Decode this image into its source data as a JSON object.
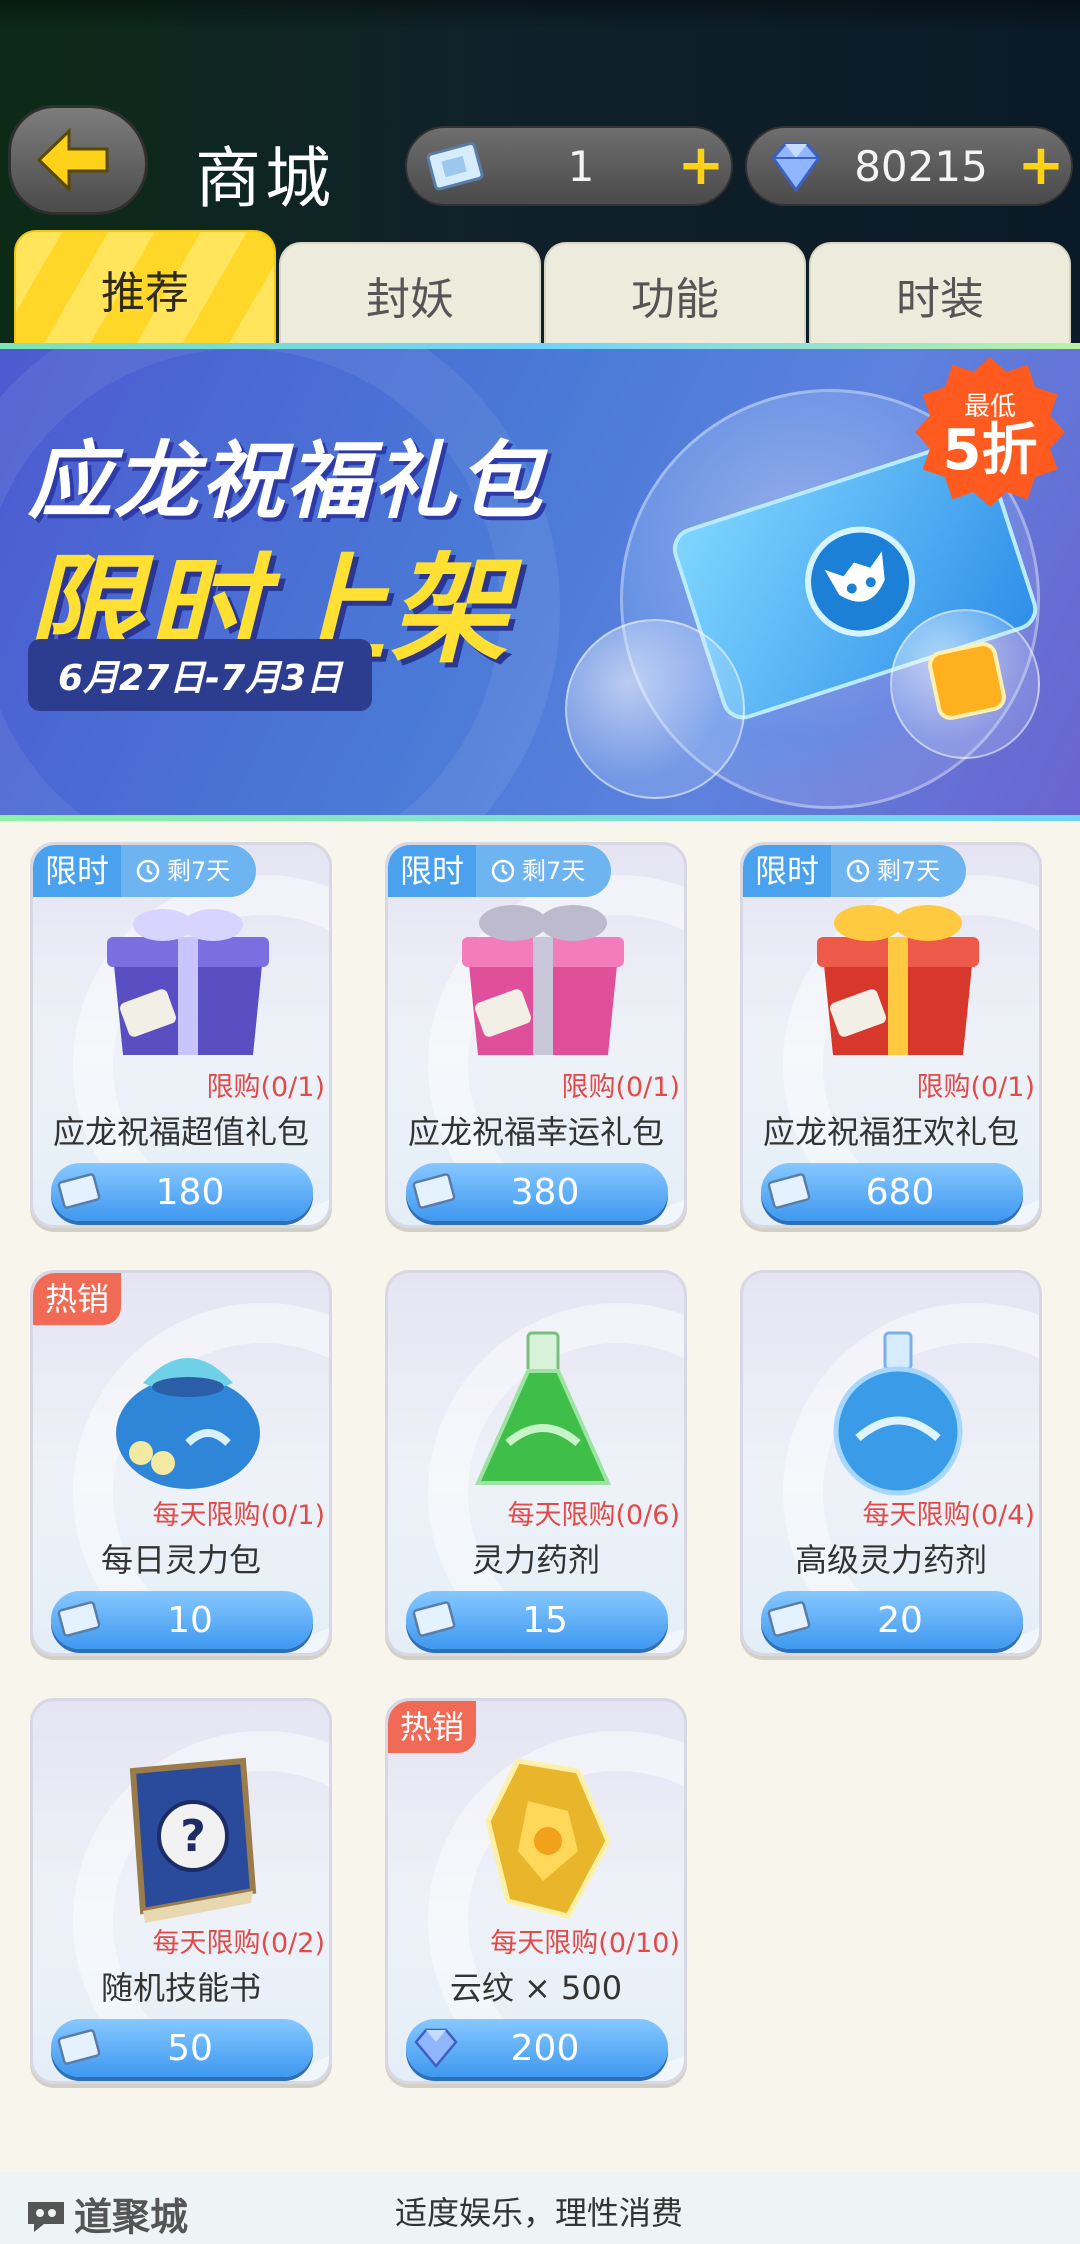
{
  "header": {
    "title": "商城",
    "tickets": "1",
    "gems": "80215",
    "plus": "+"
  },
  "tabs": [
    {
      "label": "推荐",
      "active": true
    },
    {
      "label": "封妖",
      "active": false
    },
    {
      "label": "功能",
      "active": false
    },
    {
      "label": "时装",
      "active": false
    }
  ],
  "banner": {
    "title1": "应龙祝福礼包",
    "title2": "限时上架",
    "date": "6月27日-7月3日",
    "badge_top": "最低",
    "badge_main": "5折"
  },
  "items": [
    {
      "tag": "限时",
      "tag_type": "limited",
      "timer": "剩7天",
      "limit": "限购(0/1)",
      "name": "应龙祝福超值礼包",
      "price": "180",
      "currency": "ticket-icon",
      "art": "purple-gift-box",
      "color": "#5a4fc2"
    },
    {
      "tag": "限时",
      "tag_type": "limited",
      "timer": "剩7天",
      "limit": "限购(0/1)",
      "name": "应龙祝福幸运礼包",
      "price": "380",
      "currency": "ticket-icon",
      "art": "pink-gift-box",
      "color": "#e0509a"
    },
    {
      "tag": "限时",
      "tag_type": "limited",
      "timer": "剩7天",
      "limit": "限购(0/1)",
      "name": "应龙祝福狂欢礼包",
      "price": "680",
      "currency": "ticket-icon",
      "art": "red-gift-box",
      "color": "#d8382c"
    },
    {
      "tag": "热销",
      "tag_type": "hot",
      "timer": "",
      "limit": "每天限购(0/1)",
      "name": "每日灵力包",
      "price": "10",
      "currency": "ticket-icon",
      "art": "blue-pouch",
      "color": "#2f86d8"
    },
    {
      "tag": "",
      "tag_type": "",
      "timer": "",
      "limit": "每天限购(0/6)",
      "name": "灵力药剂",
      "price": "15",
      "currency": "ticket-icon",
      "art": "green-potion",
      "color": "#3fbf4a"
    },
    {
      "tag": "",
      "tag_type": "",
      "timer": "",
      "limit": "每天限购(0/4)",
      "name": "高级灵力药剂",
      "price": "20",
      "currency": "ticket-icon",
      "art": "blue-potion",
      "color": "#3a9ce8"
    },
    {
      "tag": "",
      "tag_type": "",
      "timer": "",
      "limit": "每天限购(0/2)",
      "name": "随机技能书",
      "price": "50",
      "currency": "ticket-icon",
      "art": "skill-book",
      "color": "#2a4a9c"
    },
    {
      "tag": "热销",
      "tag_type": "hot",
      "timer": "",
      "limit": "每天限购(0/10)",
      "name": "云纹 × 500",
      "price": "200",
      "currency": "gem-icon",
      "art": "gold-crystal",
      "color": "#e9b52a"
    }
  ],
  "footer": {
    "logo": "道聚城",
    "notice": "适度娱乐，理性消费"
  }
}
